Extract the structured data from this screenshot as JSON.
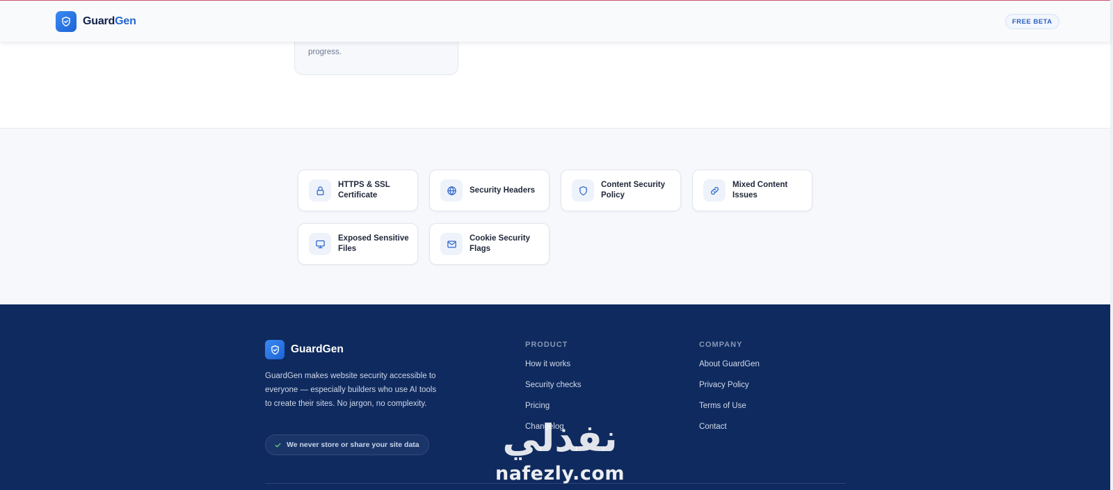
{
  "header": {
    "brand_first": "Guard",
    "brand_second": "Gen",
    "badge": "FREE BETA"
  },
  "partial_card": {
    "text": "progress."
  },
  "checks": [
    {
      "label": "HTTPS & SSL Certificate",
      "icon": "lock-icon"
    },
    {
      "label": "Security Headers",
      "icon": "globe-icon"
    },
    {
      "label": "Content Security Policy",
      "icon": "shield-icon"
    },
    {
      "label": "Mixed Content Issues",
      "icon": "link-icon"
    },
    {
      "label": "Exposed Sensitive Files",
      "icon": "monitor-icon"
    },
    {
      "label": "Cookie Security Flags",
      "icon": "mail-icon"
    }
  ],
  "footer": {
    "brand": "GuardGen",
    "description": "GuardGen makes website security accessible to everyone — especially builders who use AI tools to create their sites. No jargon, no complexity.",
    "privacy_pill": "We never store or share your site data",
    "product": {
      "title": "PRODUCT",
      "links": [
        "How it works",
        "Security checks",
        "Pricing",
        "Changelog"
      ]
    },
    "company": {
      "title": "COMPANY",
      "links": [
        "About GuardGen",
        "Privacy Policy",
        "Terms of Use",
        "Contact"
      ]
    }
  },
  "watermark": {
    "arabic": "نفذلي",
    "latin": "nafezly.com"
  },
  "colors": {
    "brand_blue": "#2466d4",
    "footer_bg": "#0f2a5e",
    "section_bg": "#f7f8fb"
  }
}
